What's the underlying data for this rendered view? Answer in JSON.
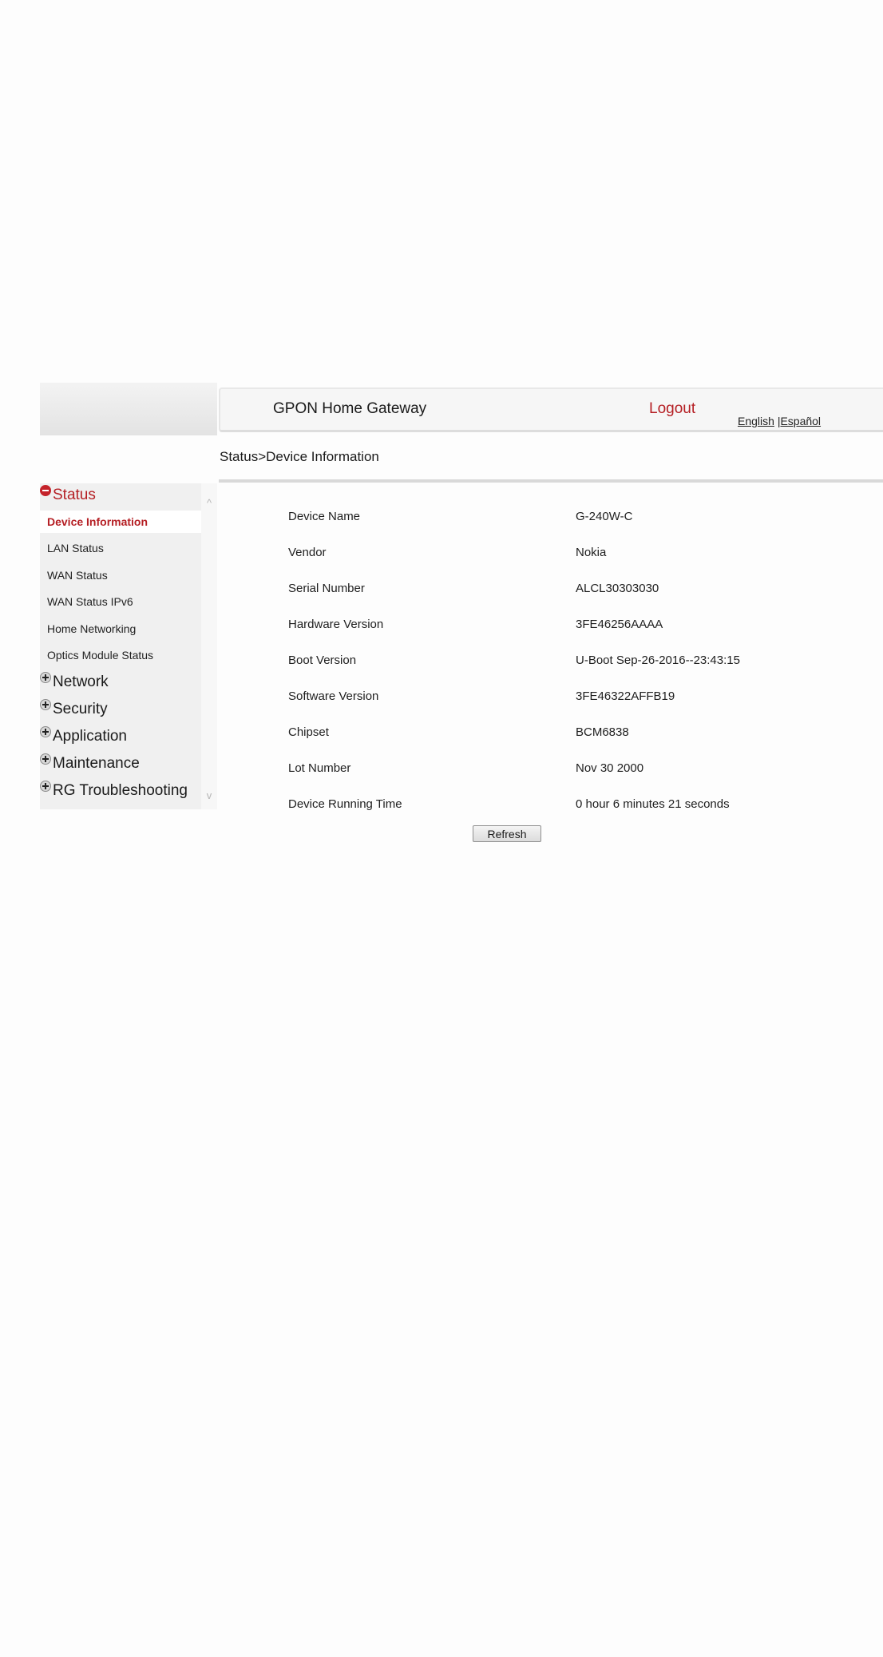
{
  "header": {
    "title": "GPON Home Gateway",
    "logout_label": "Logout",
    "lang_english": "English",
    "lang_separator": "|",
    "lang_spanish": "Español"
  },
  "breadcrumb": "Status>Device Information",
  "sidebar": {
    "status_label": "Status",
    "status_items": [
      "Device Information",
      "LAN Status",
      "WAN Status",
      "WAN Status IPv6",
      "Home Networking",
      "Optics Module Status"
    ],
    "sections": [
      "Network",
      "Security",
      "Application",
      "Maintenance",
      "RG Troubleshooting"
    ],
    "scroll_up": "^",
    "scroll_down": "v"
  },
  "device_info": [
    {
      "label": "Device Name",
      "value": "G-240W-C"
    },
    {
      "label": "Vendor",
      "value": "Nokia"
    },
    {
      "label": "Serial Number",
      "value": "ALCL30303030"
    },
    {
      "label": "Hardware Version",
      "value": "3FE46256AAAA"
    },
    {
      "label": "Boot Version",
      "value": "U-Boot Sep-26-2016--23:43:15"
    },
    {
      "label": "Software Version",
      "value": "3FE46322AFFB19"
    },
    {
      "label": "Chipset",
      "value": "BCM6838"
    },
    {
      "label": "Lot Number",
      "value": "Nov 30 2000"
    },
    {
      "label": "Device Running Time",
      "value": "0 hour 6 minutes 21 seconds"
    }
  ],
  "refresh_label": "Refresh",
  "colors": {
    "accent": "#b51f24",
    "sidebar_bg": "#f0f0f0",
    "header_bg": "#f6f6f6"
  }
}
